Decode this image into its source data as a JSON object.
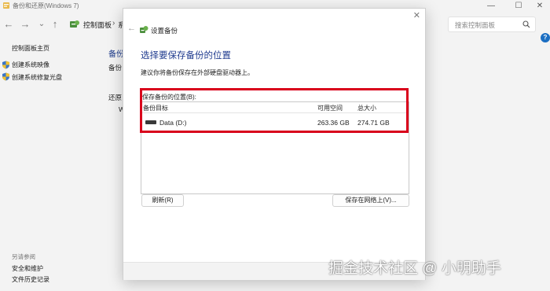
{
  "window": {
    "title": "备份和还原(Windows 7)",
    "controls": {
      "minimize": "—",
      "maximize": "☐",
      "close": "✕"
    }
  },
  "navigation": {
    "back": "←",
    "forward": "→",
    "recent": "⌄",
    "up": "↑",
    "breadcrumb": "控制面板",
    "separator": "›",
    "breadcrumb_cut": "系",
    "search_placeholder": "搜索控制面板",
    "help": "?"
  },
  "sidebar": {
    "home": "控制面板主页",
    "create_image": "创建系统映像",
    "create_repair_disc": "创建系统修复光盘",
    "see_also": "另请参阅",
    "security": "安全和维护",
    "file_history": "文件历史记录"
  },
  "main": {
    "backup_heading": "备份",
    "backup_sub": "备份",
    "restore_heading": "还原",
    "restore_char": "W"
  },
  "dialog": {
    "close": "✕",
    "back": "←",
    "window_title": "设置备份",
    "heading": "选择要保存备份的位置",
    "description": "建议你将备份保存在外部硬盘驱动器上。",
    "section_label": "保存备份的位置(B):",
    "columns": {
      "target": "备份目标",
      "free": "可用空间",
      "total": "总大小"
    },
    "drives": [
      {
        "name": "Data (D:)",
        "free": "263.36 GB",
        "total": "274.71 GB"
      }
    ],
    "refresh_button": "刷新(R)",
    "save_network_button": "保存在网络上(V)..."
  },
  "watermark": "掘金技术社区 @ 小明助手",
  "colors": {
    "highlight": "#d9001b",
    "heading": "#1f3b8f",
    "accent": "#1b6ec2"
  }
}
